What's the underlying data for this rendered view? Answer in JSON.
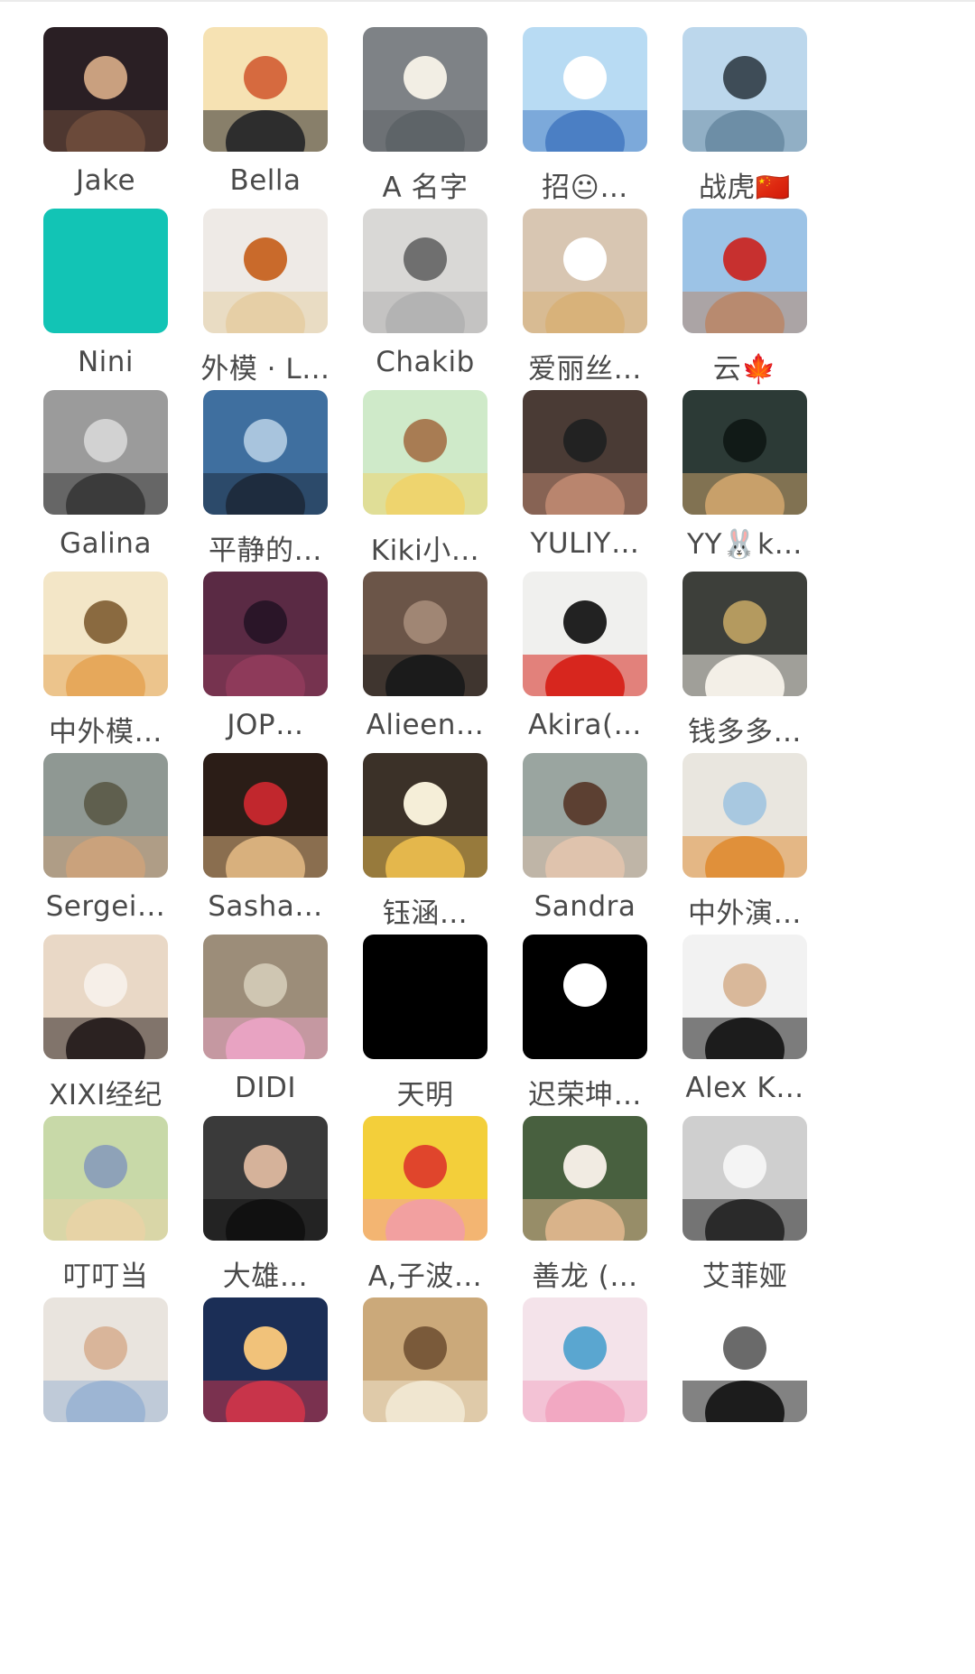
{
  "members": [
    {
      "name": "Jake",
      "colors": [
        "#2a1f24",
        "#6b4a3a",
        "#c9a07f"
      ]
    },
    {
      "name": "Bella",
      "colors": [
        "#f6e2b3",
        "#2d2d2d",
        "#d66a3f"
      ]
    },
    {
      "name": "A 名字",
      "colors": [
        "#7e8286",
        "#5e6468",
        "#f2eee4"
      ]
    },
    {
      "name": "招😐…",
      "colors": [
        "#b8dbf3",
        "#4b7fc4",
        "#ffffff"
      ]
    },
    {
      "name": "战虎🇨🇳",
      "colors": [
        "#bcd7ec",
        "#6d8ea6",
        "#3e4c57"
      ]
    },
    {
      "name": "Nini",
      "colors": [
        "#12c4b5",
        "#12c4b5",
        "#12c4b5"
      ]
    },
    {
      "name": "外模 · L…",
      "colors": [
        "#eeeae6",
        "#e6cfa6",
        "#c96a2b"
      ]
    },
    {
      "name": "Chakib",
      "colors": [
        "#d9d8d6",
        "#b3b3b3",
        "#6f6f6f"
      ]
    },
    {
      "name": "爱丽丝…",
      "colors": [
        "#d8c6b2",
        "#d8b27a",
        "#ffffff"
      ]
    },
    {
      "name": "云🍁",
      "colors": [
        "#9cc3e6",
        "#b88a6f",
        "#c7302f"
      ]
    },
    {
      "name": "Galina",
      "colors": [
        "#9b9b9b",
        "#3b3b3b",
        "#d2d2d2"
      ]
    },
    {
      "name": "平静的…",
      "colors": [
        "#3f6f9f",
        "#1e2c3e",
        "#a8c4dd"
      ]
    },
    {
      "name": "Kiki小…",
      "colors": [
        "#cfeac9",
        "#eed46e",
        "#a87c53"
      ]
    },
    {
      "name": "YULIY…",
      "colors": [
        "#4a3b35",
        "#b9856e",
        "#222222"
      ]
    },
    {
      "name": "YY🐰k…",
      "colors": [
        "#2c3a36",
        "#c8a06a",
        "#111a17"
      ]
    },
    {
      "name": "中外模…",
      "colors": [
        "#f3e6c7",
        "#e6a85b",
        "#8a6a40"
      ]
    },
    {
      "name": "JOP…",
      "colors": [
        "#5a2a44",
        "#8e3a5a",
        "#2a1528"
      ]
    },
    {
      "name": "Alieen…",
      "colors": [
        "#6b5548",
        "#1b1b1b",
        "#a08674"
      ]
    },
    {
      "name": "Akira(…",
      "colors": [
        "#f0f0ee",
        "#d7261e",
        "#222222"
      ]
    },
    {
      "name": "钱多多…",
      "colors": [
        "#3d3f3a",
        "#f3efe7",
        "#b49a5f"
      ]
    },
    {
      "name": "Sergei…",
      "colors": [
        "#8f9893",
        "#caa27c",
        "#5f5f4e"
      ]
    },
    {
      "name": "Sasha…",
      "colors": [
        "#2b1d17",
        "#d8b07d",
        "#c1272d"
      ]
    },
    {
      "name": "钰涵…",
      "colors": [
        "#3b3128",
        "#e4b74c",
        "#f5eed8"
      ]
    },
    {
      "name": "Sandra",
      "colors": [
        "#9aa5a0",
        "#dfc3ad",
        "#5c4032"
      ]
    },
    {
      "name": "中外演…",
      "colors": [
        "#e9e6df",
        "#e0903a",
        "#a8c8e0"
      ]
    },
    {
      "name": "XIXI经纪",
      "colors": [
        "#e9d8c6",
        "#2b2221",
        "#f6efe8"
      ]
    },
    {
      "name": "DIDI",
      "colors": [
        "#9c8d79",
        "#e8a3c2",
        "#cfc6b2"
      ]
    },
    {
      "name": "天明",
      "colors": [
        "#000000",
        "#000000",
        "#000000"
      ]
    },
    {
      "name": "迟荣坤…",
      "colors": [
        "#000000",
        "#000000",
        "#ffffff"
      ]
    },
    {
      "name": "Alex K…",
      "colors": [
        "#f2f2f2",
        "#1c1c1c",
        "#d9b89a"
      ]
    },
    {
      "name": "叮叮当",
      "colors": [
        "#c8d9a8",
        "#e7d3a6",
        "#8ea2b8"
      ]
    },
    {
      "name": "大雄…",
      "colors": [
        "#3a3a3a",
        "#111111",
        "#d5b29a"
      ]
    },
    {
      "name": "A,子波…",
      "colors": [
        "#f3cf3a",
        "#f2a0a0",
        "#e0452c"
      ]
    },
    {
      "name": "善龙 (…",
      "colors": [
        "#48603f",
        "#d9b38a",
        "#f1ebe2"
      ]
    },
    {
      "name": "艾菲娅",
      "colors": [
        "#cfcfcf",
        "#2a2a2a",
        "#f4f4f4"
      ]
    },
    {
      "name": "",
      "colors": [
        "#e9e4de",
        "#9db5d3",
        "#d9b59a"
      ]
    },
    {
      "name": "",
      "colors": [
        "#1b2e56",
        "#c8344a",
        "#f1c27a"
      ]
    },
    {
      "name": "",
      "colors": [
        "#cba97a",
        "#f0e6d0",
        "#7a5a3a"
      ]
    },
    {
      "name": "",
      "colors": [
        "#f4e3ea",
        "#f2a8c2",
        "#5aa6d0"
      ]
    },
    {
      "name": "",
      "colors": [
        "#ffffff",
        "#1c1c1c",
        "#6a6a6a"
      ]
    }
  ]
}
